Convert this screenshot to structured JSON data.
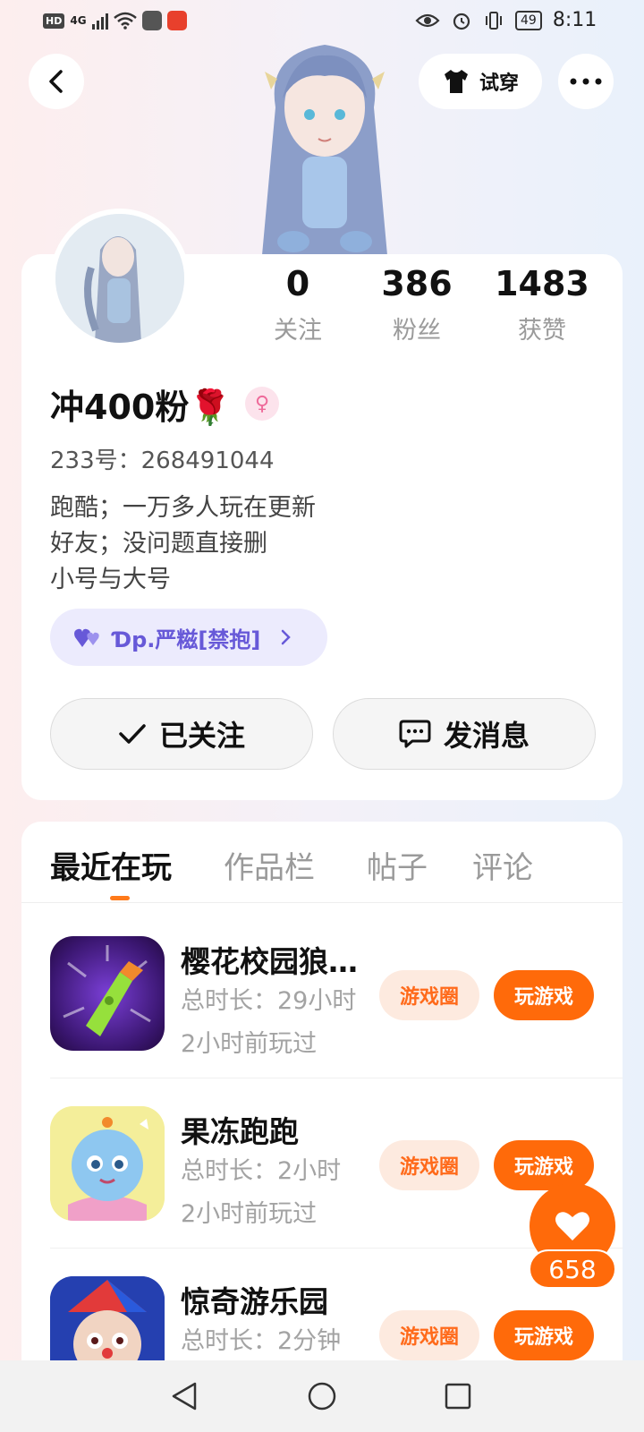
{
  "status_bar": {
    "network_badge": "HD",
    "signal_label": "4G",
    "battery": "49",
    "time": "8:11"
  },
  "header": {
    "back_icon": "back-arrow-icon",
    "try_on_label": "试穿",
    "try_on_icon": "tshirt-icon",
    "more_icon": "more-dots-icon"
  },
  "profile": {
    "stats": [
      {
        "value": "0",
        "label": "关注"
      },
      {
        "value": "386",
        "label": "粉丝"
      },
      {
        "value": "1483",
        "label": "获赞"
      }
    ],
    "nickname": "冲400粉🌹",
    "gender_icon": "female-icon",
    "uid": "233号：268491044",
    "bio": [
      "跑酷；一万多人玩在更新",
      "好友；没问题直接删",
      "小号与大号"
    ],
    "guild": "Ɗp.严糍[禁抱]",
    "follow_button": "已关注",
    "message_button": "发消息"
  },
  "tabs": [
    {
      "label": "最近在玩",
      "active": true
    },
    {
      "label": "作品栏",
      "active": false
    },
    {
      "label": "帖子",
      "active": false
    },
    {
      "label": "评论",
      "active": false
    }
  ],
  "games": [
    {
      "title": "樱花校园狼人杀",
      "duration": "总时长：29小时",
      "last_played": "2小时前玩过",
      "circle_label": "游戏圈",
      "play_label": "玩游戏"
    },
    {
      "title": "果冻跑跑",
      "duration": "总时长：2小时",
      "last_played": "2小时前玩过",
      "circle_label": "游戏圈",
      "play_label": "玩游戏"
    },
    {
      "title": "惊奇游乐园",
      "duration": "总时长：2分钟",
      "last_played": "",
      "circle_label": "游戏圈",
      "play_label": "玩游戏"
    }
  ],
  "like_fab": {
    "count": "658",
    "icon": "heart-icon"
  },
  "colors": {
    "accent": "#ff6a0a",
    "guild_text": "#6759d8",
    "gender": "#ee6a9a"
  }
}
